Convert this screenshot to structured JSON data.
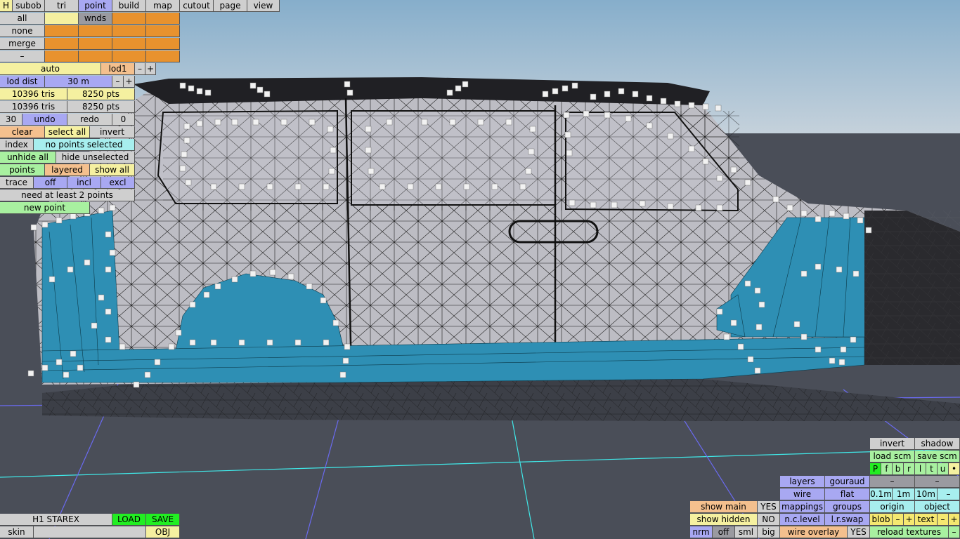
{
  "colors": {
    "sky_top": "#8ab0cc",
    "sky_bottom": "#c6d2dc",
    "ground": "#4a4e58",
    "car_body": "#bdbdc4",
    "selection": "#2e8fb4",
    "grid_blue": "#6a6af0",
    "grid_cyan": "#40e8e8"
  },
  "top_menu": [
    "H",
    "subob",
    "tri",
    "point",
    "build",
    "map",
    "cutout",
    "page",
    "view"
  ],
  "select": {
    "all": "all",
    "none": "none",
    "merge": "merge",
    "minus": "–",
    "wnds": "wnds"
  },
  "lod": {
    "auto": "auto",
    "lod1": "lod1",
    "minus": "–",
    "plus": "+",
    "lod_dist_label": "lod dist",
    "lod_dist_value": "30 m"
  },
  "stats": {
    "tris_a": "10396 tris",
    "pts_a": "8250 pts",
    "tris_b": "10396 tris",
    "pts_b": "8250 pts"
  },
  "history": {
    "count": "30",
    "undo": "undo",
    "redo": "redo",
    "redo_count": "0"
  },
  "actions": {
    "clear": "clear",
    "select_all": "select all",
    "invert": "invert",
    "index": "index",
    "no_points": "no points selected",
    "unhide_all": "unhide all",
    "hide_unselected": "hide unselected",
    "points": "points",
    "layered": "layered",
    "show_all": "show all",
    "trace": "trace",
    "off": "off",
    "incl": "incl",
    "excl": "excl",
    "need_two": "need at least 2 points",
    "new_point": "new point"
  },
  "file": {
    "name": "H1 STAREX",
    "load": "LOAD",
    "save": "SAVE",
    "skin": "skin",
    "obj": "OBJ"
  },
  "render": {
    "invert": "invert",
    "shadow": "shadow",
    "load_scm": "load scm",
    "save_scm": "save scm",
    "flags": [
      "P",
      "f",
      "b",
      "r",
      "l",
      "t",
      "u",
      "•"
    ],
    "layers": "layers",
    "gouraud": "gouraud",
    "minus1": "–",
    "minus2": "–",
    "wire": "wire",
    "flat": "flat",
    "d01": "0.1m",
    "d1": "1m",
    "d10": "10m",
    "dminus": "–",
    "mappings": "mappings",
    "groups": "groups",
    "origin": "origin",
    "object": "object",
    "nclevel": "n.c.level",
    "lrswap": "l.r.swap",
    "blob": "blob",
    "text": "text",
    "pm_minus": "–",
    "pm_plus": "+",
    "wire_overlay": "wire overlay",
    "overlay_yes": "YES",
    "reload_textures": "reload textures",
    "rt_minus": "–"
  },
  "show": {
    "show_main": "show main",
    "main_yes": "YES",
    "show_hidden": "show hidden",
    "hidden_no": "NO",
    "nrm": "nrm",
    "off": "off",
    "sml": "sml",
    "big": "big"
  }
}
